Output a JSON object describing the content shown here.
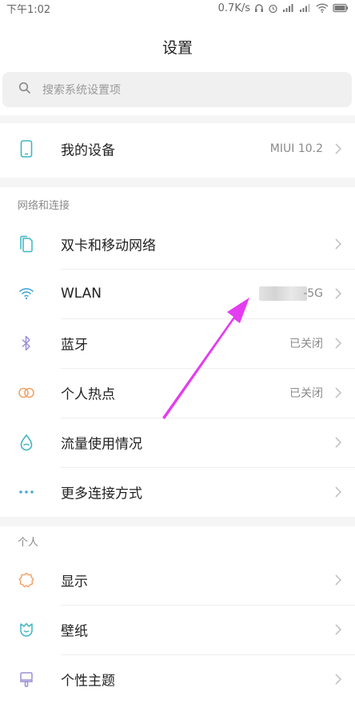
{
  "status_bar": {
    "time": "下午1:02",
    "net_speed": "0.7K/s"
  },
  "header": {
    "title": "设置"
  },
  "search": {
    "placeholder": "搜索系统设置项"
  },
  "device": {
    "label": "我的设备",
    "value": "MIUI 10.2"
  },
  "sections": {
    "network": "网络和连接",
    "personal": "个人"
  },
  "network_items": [
    {
      "label": "双卡和移动网络",
      "value": ""
    },
    {
      "label": "WLAN",
      "value": "-5G"
    },
    {
      "label": "蓝牙",
      "value": "已关闭"
    },
    {
      "label": "个人热点",
      "value": "已关闭"
    },
    {
      "label": "流量使用情况",
      "value": ""
    },
    {
      "label": "更多连接方式",
      "value": ""
    }
  ],
  "personal_items": [
    {
      "label": "显示"
    },
    {
      "label": "壁纸"
    },
    {
      "label": "个性主题"
    }
  ],
  "colors": {
    "icon_teal": "#3fb6c4",
    "icon_blue": "#4aa8d8",
    "icon_purple": "#9b8fd6",
    "icon_orange": "#f0a46a",
    "annotation_arrow": "#e43cf0"
  }
}
